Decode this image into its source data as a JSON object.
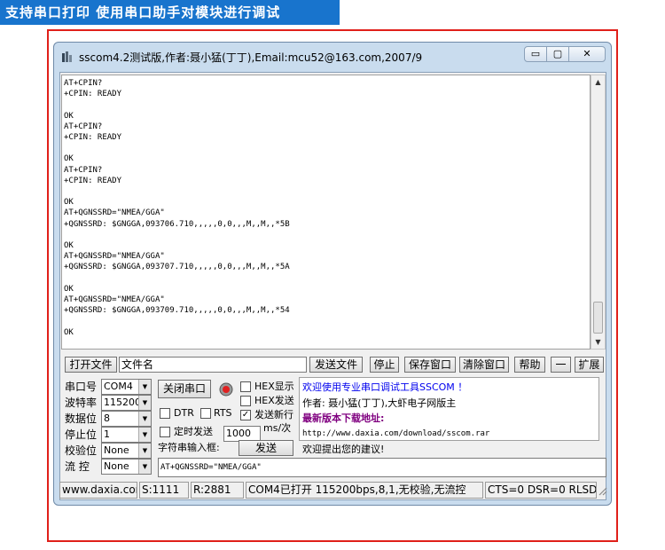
{
  "banner": {
    "text": "支持串口打印 使用串口助手对模块进行调试"
  },
  "window": {
    "title": "sscom4.2测试版,作者:聂小猛(丁丁),Email:mcu52@163.com,2007/9",
    "controls": {
      "minimize": "▭",
      "maximize": "▢",
      "close": "✕"
    }
  },
  "terminal": {
    "text": "AT+CPIN?\n+CPIN: READY\n\nOK\nAT+CPIN?\n+CPIN: READY\n\nOK\nAT+CPIN?\n+CPIN: READY\n\nOK\nAT+QGNSSRD=\"NMEA/GGA\"\n+QGNSSRD: $GNGGA,093706.710,,,,,0,0,,,M,,M,,*5B\n\nOK\nAT+QGNSSRD=\"NMEA/GGA\"\n+QGNSSRD: $GNGGA,093707.710,,,,,0,0,,,M,,M,,*5A\n\nOK\nAT+QGNSSRD=\"NMEA/GGA\"\n+QGNSSRD: $GNGGA,093709.710,,,,,0,0,,,M,,M,,*54\n\nOK"
  },
  "toolbar": {
    "open_file": "打开文件",
    "filename": "文件名",
    "send_file": "发送文件",
    "stop": "停止",
    "save_window": "保存窗口",
    "clear_window": "清除窗口",
    "help": "帮助",
    "dash": "一",
    "expand": "扩展"
  },
  "settings": {
    "port_label": "串口号",
    "port_value": "COM4",
    "baud_label": "波特率",
    "baud_value": "115200",
    "databits_label": "数据位",
    "databits_value": "8",
    "stopbits_label": "停止位",
    "stopbits_value": "1",
    "parity_label": "校验位",
    "parity_value": "None",
    "flow_label": "流 控",
    "flow_value": "None"
  },
  "controls": {
    "close_port": "关闭串口",
    "hex_display": "HEX显示",
    "hex_send": "HEX发送",
    "send_newline": "发送新行",
    "dtr": "DTR",
    "rts": "RTS",
    "timed_send": "定时发送",
    "interval": "1000",
    "interval_unit": "ms/次",
    "string_input": "字符串输入框:",
    "send": "发送",
    "send_input_value": "AT+QGNSSRD=\"NMEA/GGA\"",
    "send_newline_checked": true
  },
  "info": {
    "line1": "欢迎使用专业串口调试工具SSCOM ！",
    "line2": "作者: 聂小猛(丁丁),大虾电子网版主",
    "line3": "最新版本下载地址:",
    "line4": "http://www.daxia.com/download/sscom.rar",
    "line5": "欢迎提出您的建议!"
  },
  "status": {
    "website": "www.daxia.cor",
    "sent": "S:1111",
    "received": "R:2881",
    "port_status": "COM4已打开  115200bps,8,1,无校验,无流控",
    "lines": "CTS=0 DSR=0 RLSD"
  },
  "colors": {
    "banner": "#1874cd",
    "frame": "#e0201a",
    "info_blue": "#0000ee",
    "info_red": "#d00000",
    "info_purple": "#800080"
  }
}
